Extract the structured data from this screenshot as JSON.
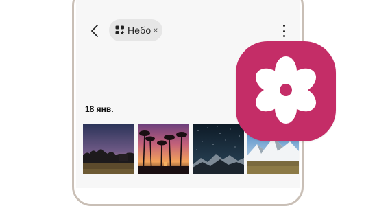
{
  "header": {
    "filter_chip": {
      "label": "Небо",
      "icon": "category-icon",
      "close_glyph": "×"
    },
    "back_icon": "chevron-left-icon",
    "more_icon": "more-vertical-icon"
  },
  "gallery": {
    "date_label": "18 янв.",
    "photos": [
      {
        "subject": "dusk-trees"
      },
      {
        "subject": "palm-sunset"
      },
      {
        "subject": "starry-mountains"
      },
      {
        "subject": "snowy-mountains"
      }
    ]
  },
  "app_icon": {
    "icon": "gallery-flower-icon",
    "color": "#c42d67"
  }
}
